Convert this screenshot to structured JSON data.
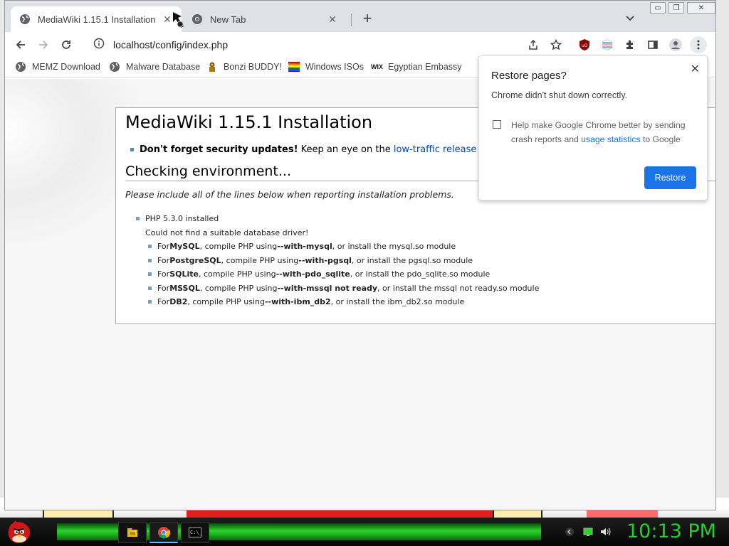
{
  "browser": {
    "tabs": [
      {
        "label": "MediaWiki 1.15.1 Installation",
        "active": true
      },
      {
        "label": "New Tab",
        "active": false
      }
    ],
    "url": "localhost/config/index.php",
    "bookmarks": [
      {
        "label": "MEMZ Download",
        "icon": "globe-icon"
      },
      {
        "label": "Malware Database",
        "icon": "globe-icon"
      },
      {
        "label": "Bonzi BUDDY!",
        "icon": "bonzi-icon"
      },
      {
        "label": "Windows ISOs",
        "icon": "windows-flag-icon"
      },
      {
        "label": "Egyptian Embassy",
        "icon": "wix-icon"
      }
    ],
    "bookmark_wix_text": "WIX"
  },
  "page": {
    "title": "MediaWiki 1.15.1 Installation",
    "security_bold": "Don't forget security updates!",
    "security_text": " Keep an eye on the ",
    "security_link": "low-traffic release announcemen",
    "section_title": "Checking environment...",
    "note": "Please include all of the lines below when reporting installation problems.",
    "php_installed": "PHP 5.3.0 installed",
    "db_error": "Could not find a suitable database driver!",
    "drivers": [
      {
        "prefix": "For ",
        "name": "MySQL",
        "mid": ", compile PHP using ",
        "flag": "--with-mysql",
        "suffix": ", or install the mysql.so module"
      },
      {
        "prefix": "For ",
        "name": "PostgreSQL",
        "mid": ", compile PHP using ",
        "flag": "--with-pgsql",
        "suffix": ", or install the pgsql.so module"
      },
      {
        "prefix": "For ",
        "name": "SQLite",
        "mid": ", compile PHP using ",
        "flag": "--with-pdo_sqlite",
        "suffix": ", or install the pdo_sqlite.so module"
      },
      {
        "prefix": "For ",
        "name": "MSSQL",
        "mid": ", compile PHP using ",
        "flag": "--with-mssql not ready",
        "suffix": ", or install the mssql not ready.so module"
      },
      {
        "prefix": "For ",
        "name": "DB2",
        "mid": ", compile PHP using ",
        "flag": "--with-ibm_db2",
        "suffix": ", or install the ibm_db2.so module"
      }
    ]
  },
  "popup": {
    "title": "Restore pages?",
    "message": "Chrome didn't shut down correctly.",
    "checkbox_text_1": "Help make Google Chrome better by sending crash reports and ",
    "checkbox_link": "usage statistics",
    "checkbox_text_2": " to Google",
    "button": "Restore"
  },
  "taskbar": {
    "clock": "10:13 PM",
    "cmd_label": "C:\\_"
  },
  "colors": {
    "accent": "#1a73e8",
    "link": "#0645ad",
    "clock": "#1ed32b"
  }
}
